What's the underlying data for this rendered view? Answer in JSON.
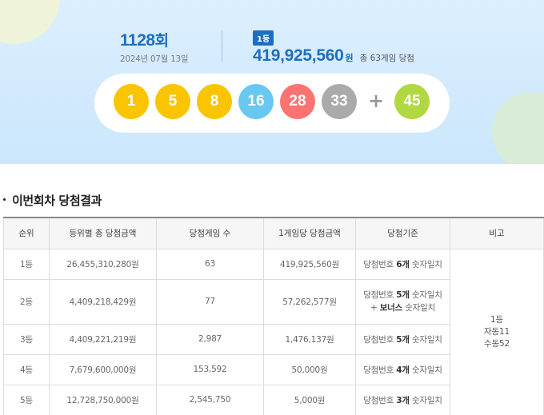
{
  "draw": {
    "round_number": "1128",
    "round_suffix": "회",
    "date": "2024년 07월 13일"
  },
  "prize": {
    "badge": "1등",
    "amount": "419,925,560",
    "unit": "원",
    "winners": "총 63게임 당첨"
  },
  "balls": [
    {
      "number": "1",
      "color": "#fbc400"
    },
    {
      "number": "5",
      "color": "#fbc400"
    },
    {
      "number": "8",
      "color": "#fbc400"
    },
    {
      "number": "16",
      "color": "#69c8f2"
    },
    {
      "number": "28",
      "color": "#ff7272"
    },
    {
      "number": "33",
      "color": "#aaaaaa"
    }
  ],
  "plus_sign": "+",
  "bonus_ball": {
    "number": "45",
    "color": "#b0d840"
  },
  "section": {
    "title": "이번회차 당첨결과"
  },
  "table": {
    "headers": [
      "순위",
      "등위별 총 당첨금액",
      "당첨게임 수",
      "1게임당 당첨금액",
      "당첨기준",
      "비고"
    ],
    "rows": [
      {
        "rank": "1등",
        "total": "26,455,310,280원",
        "games": "63",
        "per_game": "419,925,560원",
        "criteria_pre": "당첨번호 ",
        "criteria_bold": "6개",
        "criteria_post": " 숫자일치",
        "criteria_line2_bold": "",
        "criteria_line2_post": ""
      },
      {
        "rank": "2등",
        "total": "4,409,218,429원",
        "games": "77",
        "per_game": "57,262,577원",
        "criteria_pre": "당첨번호 ",
        "criteria_bold": "5개",
        "criteria_post": " 숫자일치",
        "criteria_line2_pre": "+ ",
        "criteria_line2_bold": "보너스",
        "criteria_line2_post": " 숫자일치"
      },
      {
        "rank": "3등",
        "total": "4,409,221,219원",
        "games": "2,987",
        "per_game": "1,476,137원",
        "criteria_pre": "당첨번호 ",
        "criteria_bold": "5개",
        "criteria_post": " 숫자일치"
      },
      {
        "rank": "4등",
        "total": "7,679,600,000원",
        "games": "153,592",
        "per_game": "50,000원",
        "criteria_pre": "당첨번호 ",
        "criteria_bold": "4개",
        "criteria_post": " 숫자일치"
      },
      {
        "rank": "5등",
        "total": "12,728,750,000원",
        "games": "2,545,750",
        "per_game": "5,000원",
        "criteria_pre": "당첨번호 ",
        "criteria_bold": "3개",
        "criteria_post": " 숫자일치"
      }
    ],
    "note": {
      "line1": "1등",
      "line2": "자동11",
      "line3": "수동52"
    }
  }
}
